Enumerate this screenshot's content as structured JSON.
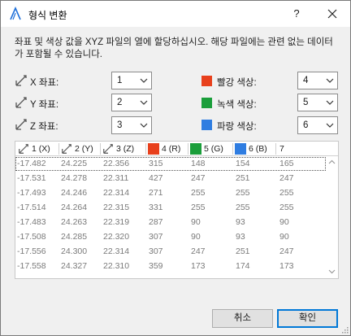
{
  "window": {
    "title": "형식 변환",
    "help_label": "?"
  },
  "intro_text": "좌표 및 색상 값을 XYZ 파일의 열에 할당하십시오. 해당 파일에는 관련 없는 데이터가 포함될 수 있습니다.",
  "coords": [
    {
      "label": "X 좌표:",
      "value": "1",
      "icon": "x-axis-icon"
    },
    {
      "label": "Y 좌표:",
      "value": "2",
      "icon": "y-axis-icon"
    },
    {
      "label": "Z 좌표:",
      "value": "3",
      "icon": "z-axis-icon"
    }
  ],
  "colors": [
    {
      "label": "빨강 색상:",
      "value": "4",
      "swatch": "#e8401c"
    },
    {
      "label": "녹색 색상:",
      "value": "5",
      "swatch": "#1a9e3a"
    },
    {
      "label": "파랑 색상:",
      "value": "6",
      "swatch": "#2f7de1"
    }
  ],
  "table": {
    "headers": [
      "1 (X)",
      "2 (Y)",
      "3 (Z)",
      "4 (R)",
      "5 (G)",
      "6 (B)",
      "7"
    ],
    "rows": [
      [
        "-17.482",
        "24.225",
        "22.356",
        "315",
        "148",
        "154",
        "165"
      ],
      [
        "-17.531",
        "24.278",
        "22.311",
        "427",
        "247",
        "251",
        "247"
      ],
      [
        "-17.493",
        "24.246",
        "22.314",
        "271",
        "255",
        "255",
        "255"
      ],
      [
        "-17.514",
        "24.264",
        "22.315",
        "331",
        "255",
        "255",
        "255"
      ],
      [
        "-17.483",
        "24.263",
        "22.319",
        "287",
        "90",
        "93",
        "90"
      ],
      [
        "-17.508",
        "24.285",
        "22.320",
        "307",
        "90",
        "93",
        "90"
      ],
      [
        "-17.556",
        "24.300",
        "22.314",
        "307",
        "247",
        "251",
        "247"
      ],
      [
        "-17.558",
        "24.327",
        "22.310",
        "359",
        "173",
        "174",
        "173"
      ]
    ]
  },
  "buttons": {
    "cancel": "취소",
    "ok": "확인"
  },
  "accent": "#0078d7"
}
